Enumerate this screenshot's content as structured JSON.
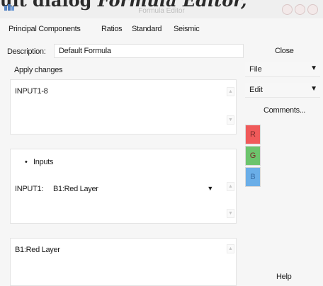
{
  "title_bar": {
    "caption_fragment_bold": "ult dialog",
    "caption_fragment_italic": "Formula Editor,",
    "window_title": "Formula Editor"
  },
  "menu": [
    "Principal Components",
    "Ratios",
    "Standard",
    "Seismic"
  ],
  "description": {
    "label": "Description:",
    "value": "Default Formula"
  },
  "buttons": {
    "close": "Close",
    "comments": "Comments...",
    "help": "Help"
  },
  "apply_changes": "Apply changes",
  "dropdowns": {
    "file": {
      "label": "File",
      "arrow": "▼"
    },
    "edit": {
      "label": "Edit",
      "arrow": "▼"
    }
  },
  "formula_text": "INPUT1-8",
  "inputs": {
    "header_bullet": "•",
    "header": "Inputs",
    "input1_label": "INPUT1:",
    "input1_value": "B1:Red Layer",
    "input1_arrow": "▼"
  },
  "layer_text": "B1:Red Layer",
  "color_buttons": [
    {
      "letter": "R",
      "color": "#f05a5a"
    },
    {
      "letter": "G",
      "color": "#6cc46c"
    },
    {
      "letter": "B",
      "color": "#6aaee8"
    }
  ],
  "colors": {
    "window_bg": "#f6f6f6",
    "panel_bg": "#ffffff"
  }
}
